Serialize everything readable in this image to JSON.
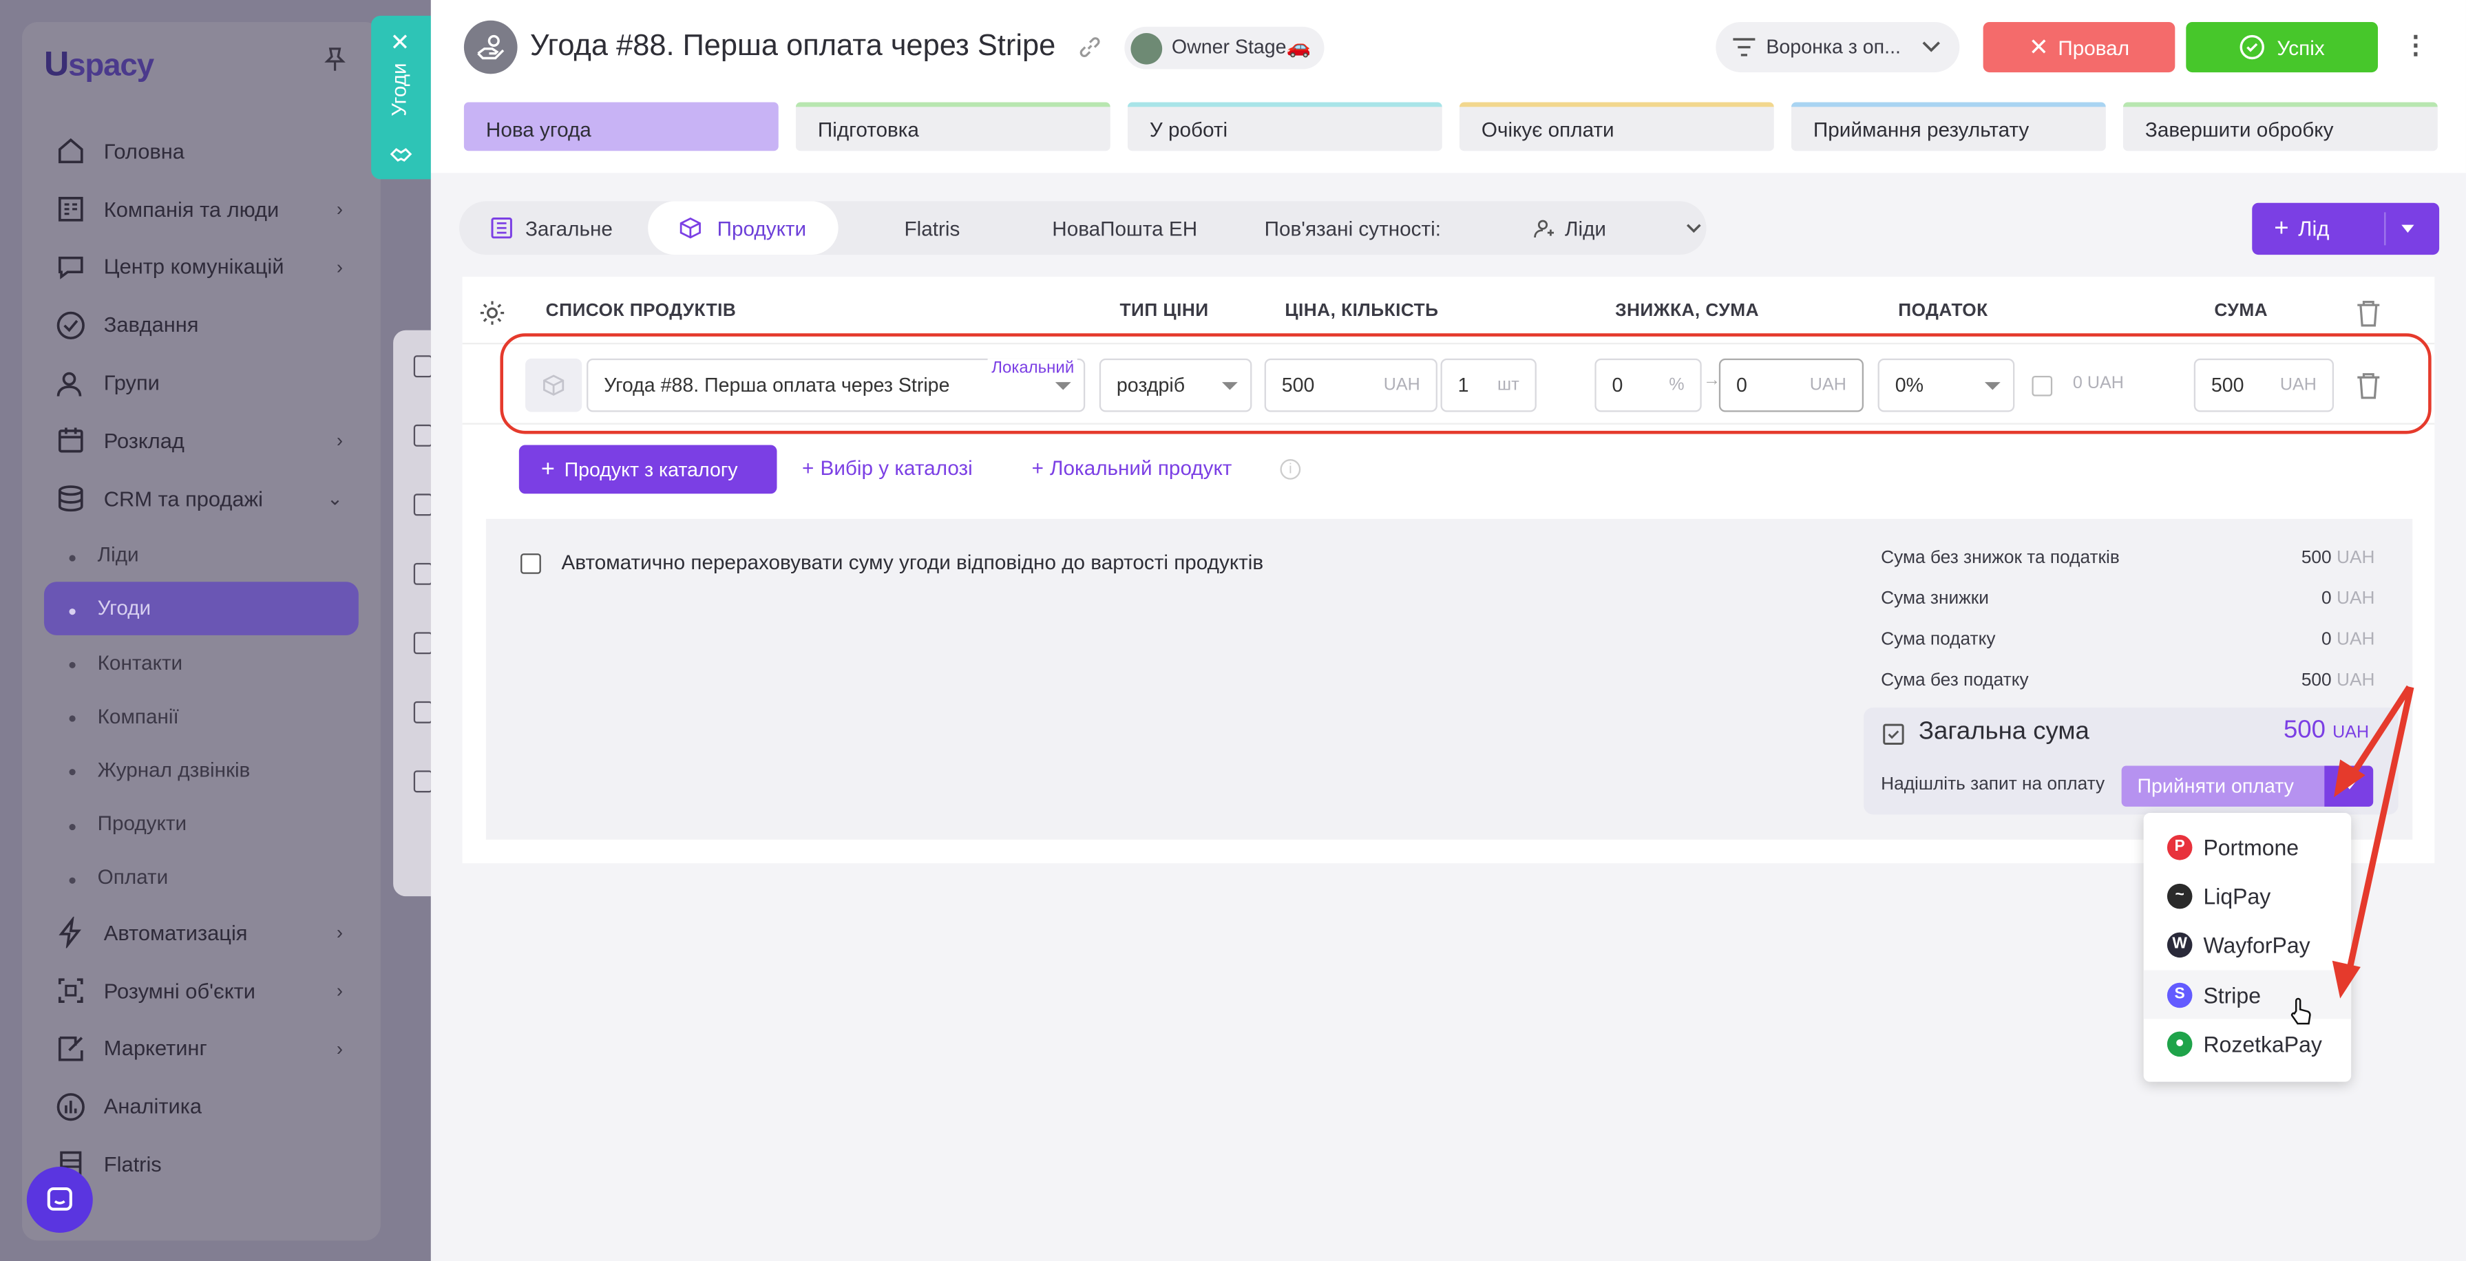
{
  "sidebar": {
    "logo_text": "spacy",
    "logo_prefix": "U",
    "items": [
      {
        "label": "Головна",
        "icon": "home-icon"
      },
      {
        "label": "Компанія та люди",
        "icon": "company-icon"
      },
      {
        "label": "Центр комунікацій",
        "icon": "chat-icon"
      },
      {
        "label": "Завдання",
        "icon": "check-circle-icon"
      },
      {
        "label": "Групи",
        "icon": "people-icon"
      },
      {
        "label": "Розклад",
        "icon": "calendar-icon"
      },
      {
        "label": "CRM та продажі",
        "icon": "database-icon"
      }
    ],
    "crm_sub": [
      "Ліди",
      "Угоди",
      "Контакти",
      "Компанії",
      "Журнал дзвінків",
      "Продукти",
      "Оплати"
    ],
    "items_bottom": [
      {
        "label": "Автоматизація",
        "icon": "bolt-icon"
      },
      {
        "label": "Розумні об'єкти",
        "icon": "smart-object-icon"
      },
      {
        "label": "Маркетинг",
        "icon": "marketing-icon"
      },
      {
        "label": "Аналітика",
        "icon": "analytics-icon"
      },
      {
        "label": "Flatris",
        "icon": "flatris-icon"
      }
    ]
  },
  "vertical_tab": {
    "label": "Угоди"
  },
  "header": {
    "title": "Угода #88. Перша оплата через Stripe",
    "owner": "Owner Stage🚗",
    "funnel": "Воронка з оп...",
    "fail_label": "Провал",
    "success_label": "Успіх"
  },
  "stages": [
    "Нова угода",
    "Підготовка",
    "У роботі",
    "Очікує оплати",
    "Приймання результату",
    "Завершити обробку"
  ],
  "stage_colors": [
    "#c8b3f5",
    "#b8e6b0",
    "#a8e4e8",
    "#f2d78e",
    "#a9d4f2",
    "#b8e6b0"
  ],
  "tabs": {
    "general": "Загальне",
    "products": "Продукти",
    "flatris": "Flatris",
    "novaposhta": "НоваПошта ЕН",
    "related": "Пов'язані сутності:",
    "leads": "Ліди"
  },
  "add_lead": "Лід",
  "products": {
    "headers": {
      "list": "СПИСОК ПРОДУКТІВ",
      "price_type": "ТИП ЦІНИ",
      "price_qty": "ЦІНА, КІЛЬКІСТЬ",
      "discount": "ЗНИЖКА, СУМА",
      "tax": "ПОДАТОК",
      "sum": "СУМА"
    },
    "row": {
      "name": "Угода #88. Перша оплата через Stripe",
      "badge": "Локальний",
      "price_type": "роздріб",
      "price": "500",
      "currency": "UAH",
      "qty": "1",
      "unit": "шт",
      "discount_pct": "0",
      "pct": "%",
      "discount_sum": "0",
      "tax": "0%",
      "tax_sum": "0",
      "total": "500"
    },
    "btn_catalog": "Продукт з каталогу",
    "btn_select": "Вибір у каталозі",
    "btn_local": "Локальний продукт"
  },
  "summary": {
    "auto_recalc": "Автоматично перераховувати суму угоди відповідно до вартості продуктів",
    "rows": [
      {
        "label": "Сума без знижок та податків",
        "value": "500"
      },
      {
        "label": "Сума знижки",
        "value": "0"
      },
      {
        "label": "Сума податку",
        "value": "0"
      },
      {
        "label": "Сума без податку",
        "value": "500"
      }
    ],
    "currency": "UAH",
    "total_label": "Загальна сума",
    "total_value": "500",
    "total_currency": "UAH",
    "pay_request": "Надішліть запит на оплату",
    "accept_payment": "Прийняти оплату"
  },
  "payment_options": [
    {
      "label": "Portmone",
      "color": "#e8323c",
      "glyph": "P"
    },
    {
      "label": "LiqPay",
      "color": "#2a2a2a",
      "glyph": "~"
    },
    {
      "label": "WayforPay",
      "color": "#2a2a3a",
      "glyph": "W"
    },
    {
      "label": "Stripe",
      "color": "#635bff",
      "glyph": "S"
    },
    {
      "label": "RozetkaPay",
      "color": "#1fa34a",
      "glyph": "●"
    }
  ],
  "accent_color": "#7b3fe4"
}
